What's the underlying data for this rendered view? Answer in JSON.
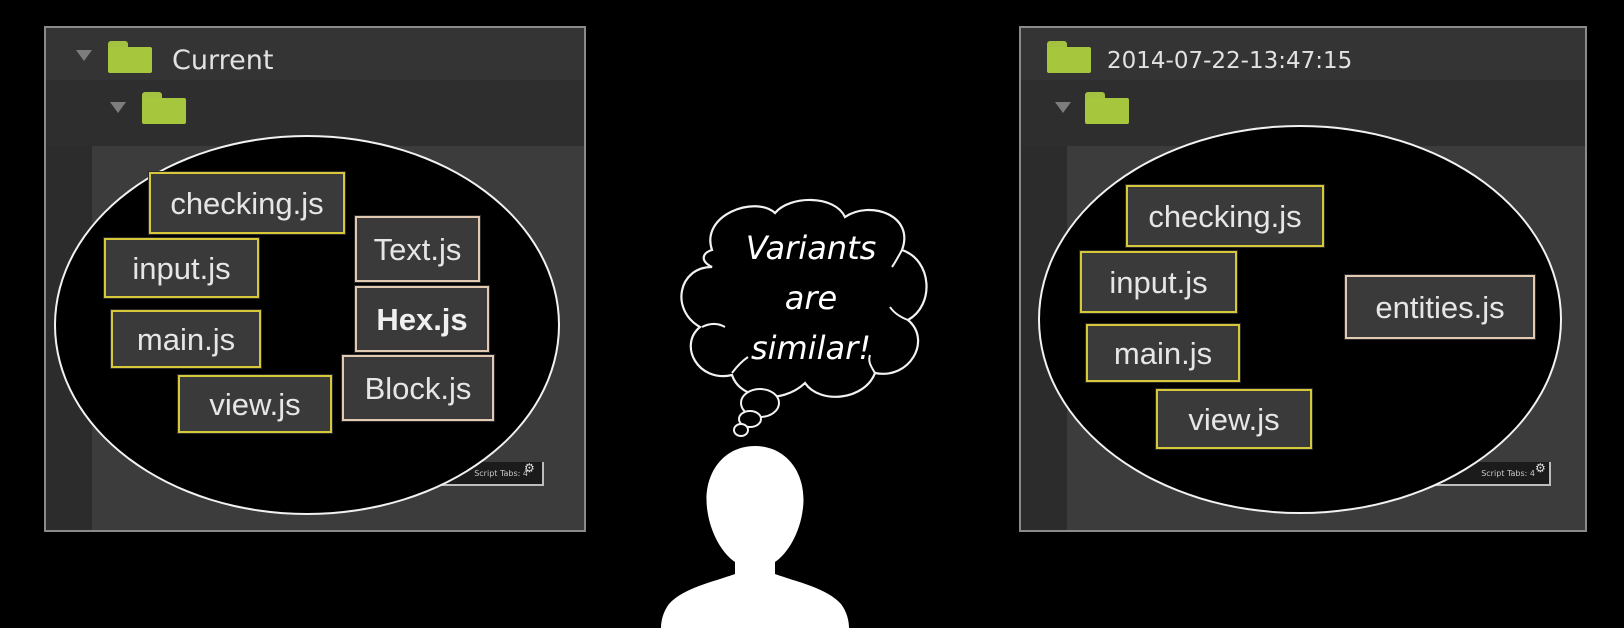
{
  "left": {
    "folder_title": "Current",
    "files_yellow": [
      {
        "id": "checking",
        "label": "checking.js"
      },
      {
        "id": "input",
        "label": "input.js"
      },
      {
        "id": "main",
        "label": "main.js"
      },
      {
        "id": "view",
        "label": "view.js"
      }
    ],
    "files_beige": [
      {
        "id": "text",
        "label": "Text.js"
      },
      {
        "id": "hex",
        "label": "Hex.js"
      },
      {
        "id": "block",
        "label": "Block.js"
      }
    ],
    "status_text": "Script  Tabs: 4"
  },
  "right": {
    "folder_title": "2014-07-22-13:47:15",
    "files_yellow": [
      {
        "id": "checking",
        "label": "checking.js"
      },
      {
        "id": "input",
        "label": "input.js"
      },
      {
        "id": "main",
        "label": "main.js"
      },
      {
        "id": "view",
        "label": "view.js"
      }
    ],
    "files_beige": [
      {
        "id": "entities",
        "label": "entities.js"
      }
    ],
    "status_text": "Script  Tabs: 4"
  },
  "thought": {
    "lines": [
      "Variants",
      "are",
      "similar!"
    ]
  },
  "icons": {
    "folder": "folder-icon",
    "expand": "triangle-down-icon",
    "gear": "gear-icon",
    "person": "person-silhouette-icon",
    "cloud": "thought-cloud-icon"
  },
  "colors": {
    "folder_green": "#a5c63d",
    "yellow_border": "#d7c83a",
    "beige_border": "#e2c9b1",
    "panel_bg": "#2c2c2c",
    "background": "#000000"
  }
}
